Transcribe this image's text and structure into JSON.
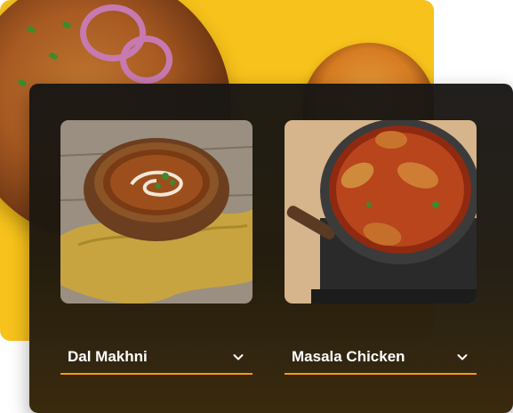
{
  "dishes": [
    {
      "label": "Dal Makhni",
      "icon": "chevron-down-icon"
    },
    {
      "label": "Masala Chicken",
      "icon": "chevron-down-icon"
    }
  ],
  "colors": {
    "accent": "#f7971e",
    "background_panel": "#f7c21b",
    "card": "#1b1916"
  }
}
